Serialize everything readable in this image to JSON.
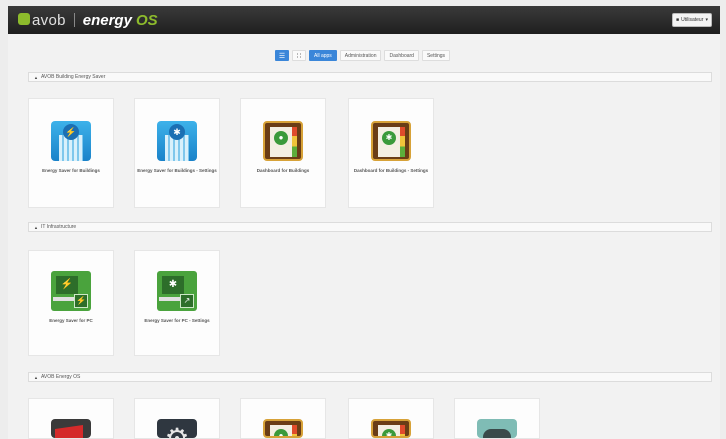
{
  "header": {
    "logo_avob": "avob",
    "logo_energy": "energy",
    "logo_os": "OS",
    "user_label": "Utilisateur",
    "user_caret": "▾"
  },
  "filter": {
    "view_list_icon": "list-view-icon",
    "view_grid_icon": "grid-view-icon",
    "tabs": [
      "All apps",
      "Administration",
      "Dashboard",
      "Settings"
    ],
    "active_tab": "All apps"
  },
  "sections": [
    {
      "title": "AVOB Building Energy Saver",
      "apps": [
        {
          "label": "Energy Saver for Buildings",
          "icon": "building-energy-icon"
        },
        {
          "label": "Energy Saver for Buildings - Settings",
          "icon": "building-settings-icon"
        },
        {
          "label": "Dashboard for Buildings",
          "icon": "dashboard-icon"
        },
        {
          "label": "Dashboard for Buildings - Settings",
          "icon": "dashboard-settings-icon"
        }
      ]
    },
    {
      "title": "IT Infrastructure",
      "apps": [
        {
          "label": "Energy Saver for PC",
          "icon": "pc-energy-icon"
        },
        {
          "label": "Energy Saver for PC - Settings",
          "icon": "pc-settings-icon"
        }
      ]
    },
    {
      "title": "AVOB Energy OS",
      "apps": [
        {
          "label": "",
          "icon": "red-flag-icon"
        },
        {
          "label": "",
          "icon": "gear-icon"
        },
        {
          "label": "",
          "icon": "dashboard-icon"
        },
        {
          "label": "",
          "icon": "dashboard-settings-icon"
        },
        {
          "label": "",
          "icon": "cloud-icon"
        }
      ]
    }
  ],
  "colors": {
    "accent": "#3a86d9",
    "brand_green": "#8dbb2c",
    "topbar": "#2a2a2a"
  }
}
